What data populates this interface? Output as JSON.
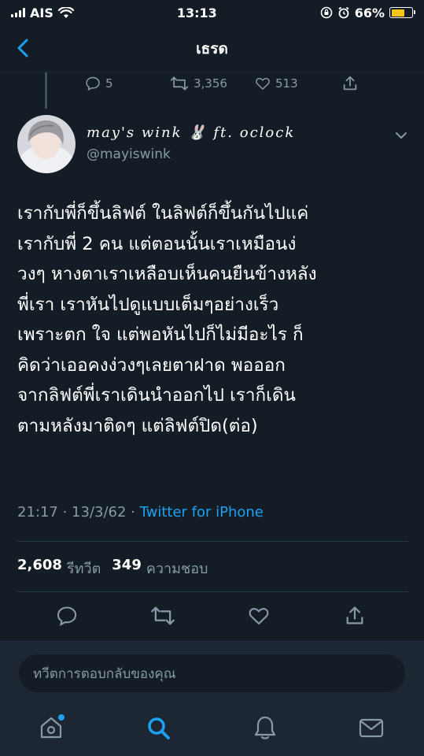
{
  "status_bar": {
    "carrier": "AIS",
    "time": "13:13",
    "battery_percent": "66%",
    "battery_level": 0.66
  },
  "nav": {
    "title": "เธรด"
  },
  "previous_tweet": {
    "replies": "5",
    "retweets": "3,356",
    "likes": "513"
  },
  "tweet": {
    "author_name": "may's wink 🐰 ft. oclock",
    "author_handle": "@mayiswink",
    "lines": [
      "เรากับพี่ก็ขึ้นลิฟต์ ในลิฟต์ก็ขึ้นกันไปแค่",
      "เรากับพี่ 2 คน แต่ตอนนั้นเราเหมือนง่",
      "วงๆ หางตาเราเหลือบเห็นคนยืนข้างหลัง",
      "พี่เรา เราหันไปดูแบบเต็มๆอย่างเร็ว",
      "เพราะตก ใจ แต่พอหันไปก็ไม่มีอะไร ก็",
      "คิดว่าเออคงง่วงๆเลยตาฝาด พอออก",
      "จากลิฟต์พี่เราเดินนำออกไป เราก็เดิน",
      "ตามหลังมาติดๆ แต่ลิฟต์ปิด(ต่อ)"
    ],
    "timestamp": "21:17 · 13/3/62 · ",
    "source": "Twitter for iPhone",
    "retweet_count": "2,608",
    "retweet_label": "รีทวีต",
    "like_count": "349",
    "like_label": "ความชอบ"
  },
  "reply": {
    "placeholder": "ทวีตการตอบกลับของคุณ"
  },
  "colors": {
    "background": "#141d26",
    "accent": "#1da1f2",
    "muted": "#8899a6",
    "battery": "#f5c518"
  },
  "icons": [
    "back-arrow-icon",
    "reply-icon",
    "retweet-icon",
    "like-icon",
    "share-icon",
    "chevron-down-icon",
    "home-icon",
    "search-icon",
    "notifications-icon",
    "messages-icon",
    "wifi-icon",
    "signal-icon",
    "lock-rotation-icon",
    "alarm-icon",
    "battery-icon"
  ]
}
